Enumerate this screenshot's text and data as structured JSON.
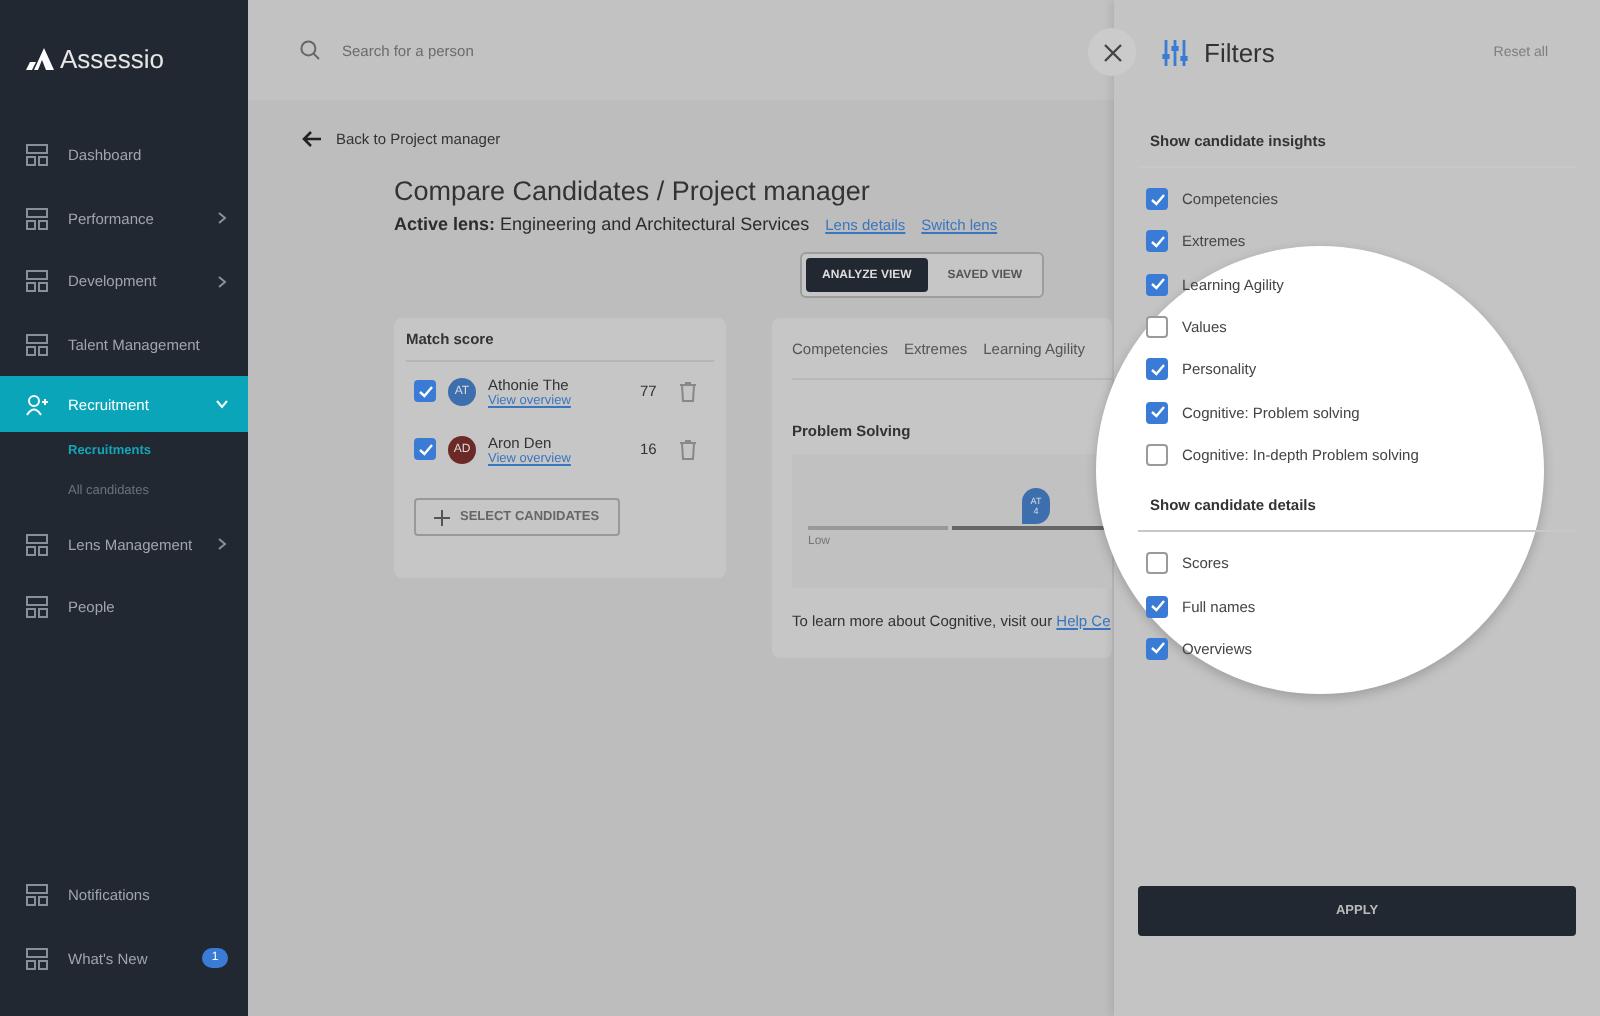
{
  "sidebar": {
    "logo": "Assessio",
    "items": [
      {
        "label": "Dashboard",
        "selected": false,
        "has_submenu": false
      },
      {
        "label": "Performance",
        "selected": false,
        "has_submenu": true
      },
      {
        "label": "Development",
        "selected": false,
        "has_submenu": true
      },
      {
        "label": "Talent Management",
        "selected": false,
        "has_submenu": false
      },
      {
        "label": "Recruitment",
        "selected": true,
        "has_submenu": true,
        "expanded": true,
        "children": [
          {
            "label": "Recruitments",
            "selected": true
          },
          {
            "label": "All candidates",
            "selected": false
          }
        ]
      },
      {
        "label": "Lens Management",
        "selected": false,
        "has_submenu": true
      },
      {
        "label": "People",
        "selected": false,
        "has_submenu": false
      }
    ],
    "bottom_items": [
      {
        "label": "Notifications"
      },
      {
        "label": "What's New",
        "badge": "1"
      }
    ]
  },
  "search": {
    "placeholder": "Search for a person"
  },
  "back_link": "Back to Project manager",
  "title": "Compare Candidates / Project manager",
  "active_lens": {
    "label": "Active lens:",
    "value": "Engineering and Architectural Services",
    "links": [
      "Lens details",
      "Switch lens"
    ]
  },
  "view_toggle": [
    {
      "label": "ANALYZE VIEW",
      "selected": true
    },
    {
      "label": "SAVED VIEW",
      "selected": false
    }
  ],
  "match_card": {
    "title": "Match score",
    "candidates": [
      {
        "initials": "AT",
        "color": "#3d6fae",
        "name": "Athonie The",
        "link": "View overview",
        "score": "77",
        "checked": true
      },
      {
        "initials": "AD",
        "color": "#6b2a26",
        "name": "Aron Den",
        "link": "View overview",
        "score": "16",
        "checked": true
      }
    ],
    "button": "SELECT CANDIDATES"
  },
  "insight_card": {
    "tabs": [
      "Competencies",
      "Extremes",
      "Learning Agility"
    ],
    "section": "Problem Solving",
    "scale_label": "Low",
    "marker": {
      "initials": "AT",
      "value": "4"
    },
    "footer": "To learn more about Cognitive, visit our",
    "footer_link": "Help Ce"
  },
  "filters": {
    "title": "Filters",
    "reset": "Reset all",
    "sections": [
      {
        "title": "Show candidate insights",
        "options": [
          {
            "label": "Competencies",
            "checked": true
          },
          {
            "label": "Extremes",
            "checked": true
          },
          {
            "label": "Learning Agility",
            "checked": true
          },
          {
            "label": "Values",
            "checked": false
          },
          {
            "label": "Personality",
            "checked": true
          },
          {
            "label": "Cognitive: Problem solving",
            "checked": true
          },
          {
            "label": "Cognitive: In-depth Problem solving",
            "checked": false
          }
        ]
      },
      {
        "title": "Show candidate details",
        "options": [
          {
            "label": "Scores",
            "checked": false
          },
          {
            "label": "Full names",
            "checked": true
          },
          {
            "label": "Overviews",
            "checked": true
          }
        ]
      }
    ],
    "apply": "APPLY"
  }
}
